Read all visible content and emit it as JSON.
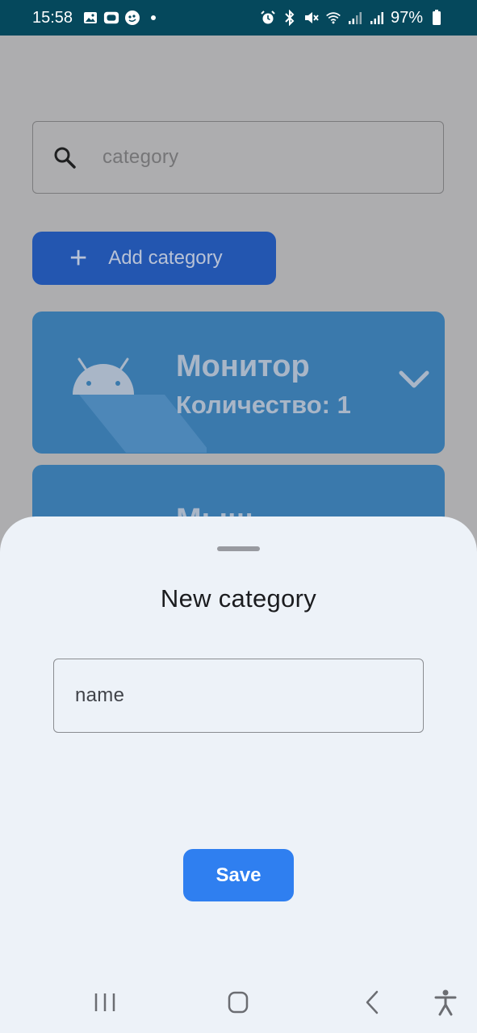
{
  "status_bar": {
    "time": "15:58",
    "battery": "97%",
    "left_icons": [
      "image-icon",
      "tv-icon",
      "chat-icon",
      "dot-icon"
    ],
    "right_icons": [
      "alarm-icon",
      "bluetooth-icon",
      "mute-icon",
      "wifi-icon",
      "signal-icon",
      "signal-icon",
      "battery-icon"
    ]
  },
  "search": {
    "placeholder": "category"
  },
  "add_button": {
    "label": "Add category"
  },
  "categories": [
    {
      "name": "Монитор",
      "count_text": "Количество: 1"
    },
    {
      "name": "Мыш"
    }
  ],
  "sheet": {
    "title": "New category",
    "name_placeholder": "name",
    "save_label": "Save"
  },
  "colors": {
    "accent": "#2f7ff0",
    "status_bar": "#05485c",
    "sheet_background": "#edf2f8"
  }
}
